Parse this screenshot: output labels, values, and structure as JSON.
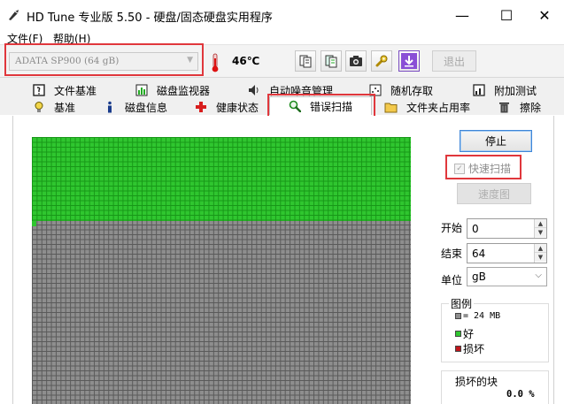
{
  "window": {
    "title": "HD Tune 专业版 5.50 - 硬盘/固态硬盘实用程序",
    "controls": [
      "—",
      "☐",
      "✕"
    ]
  },
  "menu": [
    {
      "label": "文件(F)"
    },
    {
      "label": "帮助(H)"
    }
  ],
  "toolbar": {
    "drive": "ADATA SP900 (64 gB)",
    "temperature": "46℃",
    "exit_label": "退出"
  },
  "tabs_row1": [
    {
      "label": "文件基准",
      "icon": "file-benchmark-icon"
    },
    {
      "label": "磁盘监视器",
      "icon": "disk-monitor-icon"
    },
    {
      "label": "自动噪音管理",
      "icon": "speaker-icon"
    },
    {
      "label": "随机存取",
      "icon": "random-access-icon"
    },
    {
      "label": "附加测试",
      "icon": "extra-tests-icon"
    }
  ],
  "tabs_row2": [
    {
      "label": "基准",
      "icon": "bulb-icon"
    },
    {
      "label": "磁盘信息",
      "icon": "info-icon"
    },
    {
      "label": "健康状态",
      "icon": "health-cross-icon"
    },
    {
      "label": "错误扫描",
      "icon": "magnifier-icon",
      "active": true
    },
    {
      "label": "文件夹占用率",
      "icon": "folder-icon"
    },
    {
      "label": "擦除",
      "icon": "trash-icon"
    }
  ],
  "scan": {
    "stop_label": "停止",
    "quick_scan_label": "快速扫描",
    "quick_scan_checked": true,
    "speed_map_label": "速度图",
    "start_label": "开始",
    "start_value": "0",
    "end_label": "结束",
    "end_value": "64",
    "unit_label": "单位",
    "unit_value": "gB",
    "progress_fraction": 0.32
  },
  "legend": {
    "title": "图例",
    "block_size": "= 24 MB",
    "good": "好",
    "bad": "损坏",
    "colors": {
      "block": "#8e8e8e",
      "good": "#2fc62f",
      "bad": "#c0161c"
    }
  },
  "bad_blocks": {
    "title": "损坏的块",
    "value": "0.0 %"
  }
}
